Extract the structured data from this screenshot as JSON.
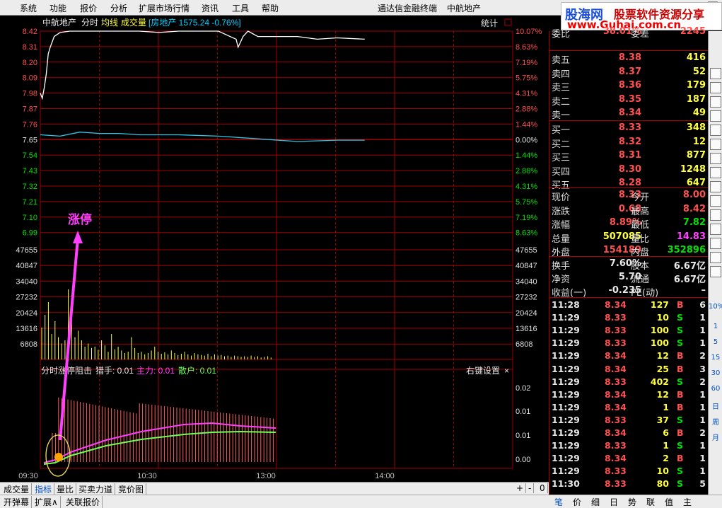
{
  "menu": {
    "items": [
      "系统",
      "功能",
      "报价",
      "分析",
      "扩展市场行情",
      "资讯",
      "工具",
      "帮助"
    ],
    "center_title": "通达信金融终端",
    "stock_title": "中航地产"
  },
  "logo": {
    "name_blue": "股海网",
    "name_red": "股票软件资源分享",
    "url": "www.Guhai.com.cn"
  },
  "chart_header": {
    "stock": "中航地产",
    "mode": "分时",
    "avg_label": "均线",
    "vol_label": "成交量",
    "index_info": "[房地产 1575.24 -0.76%]",
    "stat_label": "统计"
  },
  "price_axis": {
    "left": [
      "8.42",
      "8.31",
      "8.20",
      "8.09",
      "7.98",
      "7.87",
      "7.76",
      "7.65",
      "7.54",
      "7.43",
      "7.32",
      "7.21",
      "7.10",
      "6.99"
    ],
    "right": [
      "10.07%",
      "8.63%",
      "7.19%",
      "5.75%",
      "4.31%",
      "2.88%",
      "1.44%",
      "0.00%",
      "1.44%",
      "2.88%",
      "4.31%",
      "5.75%",
      "7.19%",
      "8.63%"
    ]
  },
  "vol_axis": [
    "47655",
    "40847",
    "34040",
    "27232",
    "20424",
    "13616",
    "6808"
  ],
  "annotation": {
    "text": "涨停"
  },
  "indicator": {
    "title": "分时涨停阻击",
    "hunter": "猎手: 0.01",
    "main": "主力: 0.01",
    "retail": "散户: 0.01",
    "settings": "右键设置",
    "close": "×",
    "axis": [
      "0.02",
      "0.01",
      "0.01",
      "0.00"
    ]
  },
  "time_axis": [
    "09:30",
    "10:30",
    "13:00",
    "14:00"
  ],
  "bottom_tabs": [
    "成交量",
    "指标",
    "量比",
    "买卖力道",
    "竞价图"
  ],
  "bottom_tabs2": [
    "开弹幕",
    "扩展∧",
    "关联报价"
  ],
  "bottom_ctrl": [
    "+",
    "-",
    "0"
  ],
  "quote": {
    "top_partial": {
      "l": "委比",
      "p": "38.01%",
      "l2": "委差",
      "v": "2245"
    },
    "asks": [
      {
        "l": "卖五",
        "p": "8.38",
        "v": "416"
      },
      {
        "l": "卖四",
        "p": "8.37",
        "v": "52"
      },
      {
        "l": "卖三",
        "p": "8.36",
        "v": "179"
      },
      {
        "l": "卖二",
        "p": "8.35",
        "v": "187"
      },
      {
        "l": "卖一",
        "p": "8.34",
        "v": "49"
      }
    ],
    "bids": [
      {
        "l": "买一",
        "p": "8.33",
        "v": "348"
      },
      {
        "l": "买二",
        "p": "8.32",
        "v": "12"
      },
      {
        "l": "买三",
        "p": "8.31",
        "v": "877"
      },
      {
        "l": "买四",
        "p": "8.30",
        "v": "1248"
      },
      {
        "l": "买五",
        "p": "8.28",
        "v": "647"
      }
    ],
    "stats": [
      {
        "l": "现价",
        "p": "8.33",
        "l2": "今开",
        "v": "8.00"
      },
      {
        "l": "涨跌",
        "p": "0.68",
        "l2": "最高",
        "v": "8.42"
      },
      {
        "l": "涨幅",
        "p": "8.89%",
        "l2": "最低",
        "v": "7.82"
      },
      {
        "l": "总量",
        "p": "507085",
        "l2": "量比",
        "v": "14.83"
      },
      {
        "l": "外盘",
        "p": "154189",
        "l2": "内盘",
        "v": "352896"
      }
    ],
    "stats2": [
      {
        "l": "换手",
        "p": "7.60%",
        "l2": "股本",
        "v": "6.67亿"
      },
      {
        "l": "净资",
        "p": "5.70",
        "l2": "流通",
        "v": "6.67亿"
      },
      {
        "l": "收益(一)",
        "p": "-0.235",
        "l2": "PE(动)",
        "v": "–"
      }
    ]
  },
  "ticks": [
    {
      "t": "11:28",
      "p": "8.34",
      "v": "127",
      "s": "B",
      "n": "6"
    },
    {
      "t": "11:29",
      "p": "8.33",
      "v": "10",
      "s": "S",
      "n": "1"
    },
    {
      "t": "11:29",
      "p": "8.33",
      "v": "100",
      "s": "S",
      "n": "1"
    },
    {
      "t": "11:29",
      "p": "8.33",
      "v": "100",
      "s": "S",
      "n": "1"
    },
    {
      "t": "11:29",
      "p": "8.34",
      "v": "12",
      "s": "B",
      "n": "2"
    },
    {
      "t": "11:29",
      "p": "8.34",
      "v": "25",
      "s": "B",
      "n": "3"
    },
    {
      "t": "11:29",
      "p": "8.33",
      "v": "402",
      "s": "S",
      "n": "2"
    },
    {
      "t": "11:29",
      "p": "8.34",
      "v": "12",
      "s": "B",
      "n": "1"
    },
    {
      "t": "11:29",
      "p": "8.34",
      "v": "1",
      "s": "B",
      "n": "1"
    },
    {
      "t": "11:29",
      "p": "8.33",
      "v": "37",
      "s": "S",
      "n": "1"
    },
    {
      "t": "11:29",
      "p": "8.34",
      "v": "6",
      "s": "B",
      "n": "2"
    },
    {
      "t": "11:29",
      "p": "8.33",
      "v": "1",
      "s": "S",
      "n": "1"
    },
    {
      "t": "11:29",
      "p": "8.34",
      "v": "2",
      "s": "B",
      "n": "1"
    },
    {
      "t": "11:29",
      "p": "8.33",
      "v": "10",
      "s": "S",
      "n": "1"
    },
    {
      "t": "11:30",
      "p": "8.33",
      "v": "80",
      "s": "S",
      "n": "5"
    }
  ],
  "quote_tabs": [
    "笔",
    "价",
    "细",
    "日",
    "势",
    "联",
    "值",
    "主"
  ],
  "side_numbers": [
    "10%",
    "1",
    "5",
    "15",
    "30",
    "60",
    "日",
    "周",
    "月"
  ],
  "colors": {
    "up": "#ff5050",
    "down": "#00e000",
    "grid": "#a00000",
    "price": "#ffffff",
    "avg": "#ffff40",
    "magenta": "#ff40ff"
  },
  "chart_data": {
    "type": "line",
    "price_series": [
      [
        0,
        7.96
      ],
      [
        2,
        7.92
      ],
      [
        4,
        8.0
      ],
      [
        6,
        8.1
      ],
      [
        8,
        8.25
      ],
      [
        10,
        8.3
      ],
      [
        14,
        8.38
      ],
      [
        20,
        8.41
      ],
      [
        30,
        8.42
      ],
      [
        60,
        8.42
      ],
      [
        100,
        8.42
      ],
      [
        120,
        8.41
      ],
      [
        140,
        8.42
      ],
      [
        180,
        8.42
      ],
      [
        198,
        8.36
      ],
      [
        200,
        8.3
      ],
      [
        205,
        8.38
      ],
      [
        210,
        8.42
      ],
      [
        220,
        8.38
      ],
      [
        240,
        8.38
      ],
      [
        260,
        8.38
      ],
      [
        280,
        8.36
      ],
      [
        300,
        8.37
      ],
      [
        328,
        8.36
      ]
    ],
    "avg_series": [
      [
        0,
        7.65
      ],
      [
        20,
        7.64
      ],
      [
        40,
        7.67
      ],
      [
        60,
        7.66
      ],
      [
        80,
        7.66
      ],
      [
        100,
        7.65
      ],
      [
        140,
        7.65
      ],
      [
        180,
        7.64
      ],
      [
        220,
        7.62
      ],
      [
        260,
        7.6
      ],
      [
        300,
        7.61
      ],
      [
        328,
        7.61
      ]
    ]
  }
}
